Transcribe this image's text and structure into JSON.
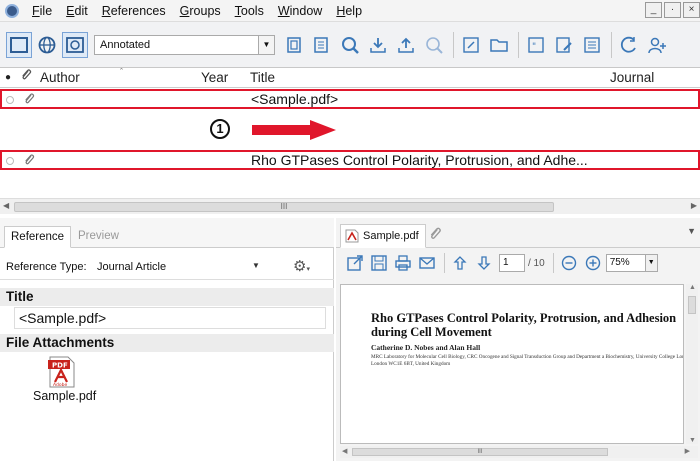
{
  "menu": {
    "items": [
      {
        "label": "File",
        "accel": "F"
      },
      {
        "label": "Edit",
        "accel": "E"
      },
      {
        "label": "References",
        "accel": "R"
      },
      {
        "label": "Groups",
        "accel": "G"
      },
      {
        "label": "Tools",
        "accel": "T"
      },
      {
        "label": "Window",
        "accel": "W"
      },
      {
        "label": "Help",
        "accel": "H"
      }
    ],
    "window_controls": [
      "_",
      "·",
      "×"
    ]
  },
  "toolbar": {
    "style_value": "Annotated"
  },
  "reference_list": {
    "columns": {
      "author": "Author",
      "year": "Year",
      "title": "Title",
      "journal": "Journal"
    },
    "rows": [
      {
        "title": "<Sample.pdf>"
      },
      {
        "title": "Rho GTPases Control Polarity, Protrusion, and Adhe..."
      }
    ],
    "step_badge": "1",
    "scrollbar_grip": "III"
  },
  "left_panel": {
    "tabs": {
      "reference": "Reference",
      "preview": "Preview"
    },
    "reference_type_label": "Reference Type:",
    "reference_type_value": "Journal Article",
    "title_heading": "Title",
    "title_value": "<Sample.pdf>",
    "attachments_heading": "File Attachments",
    "attachment_name": "Sample.pdf",
    "pdf_icon_label": "PDF",
    "pdf_icon_brand": "Adobe"
  },
  "right_panel": {
    "tab_label": "Sample.pdf",
    "page_current": "1",
    "page_total": "/ 10",
    "zoom": "75%",
    "scrollbar_grip": "III",
    "pdf": {
      "title": "Rho GTPases Control Polarity, Protrusion, and Adhesion during Cell Movement",
      "authors": "Catherine D. Nobes and Alan Hall",
      "affiliation": "MRC Laboratory for Molecular Cell Biology, CRC Oncogene and Signal Transduction Group and Department a Biochemistry, University College London, London WC1E 6BT, United Kingdom"
    }
  },
  "colors": {
    "highlight": "#e0162b",
    "arrow": "#e0162b",
    "toolbar_icon": "#3b78b8"
  }
}
